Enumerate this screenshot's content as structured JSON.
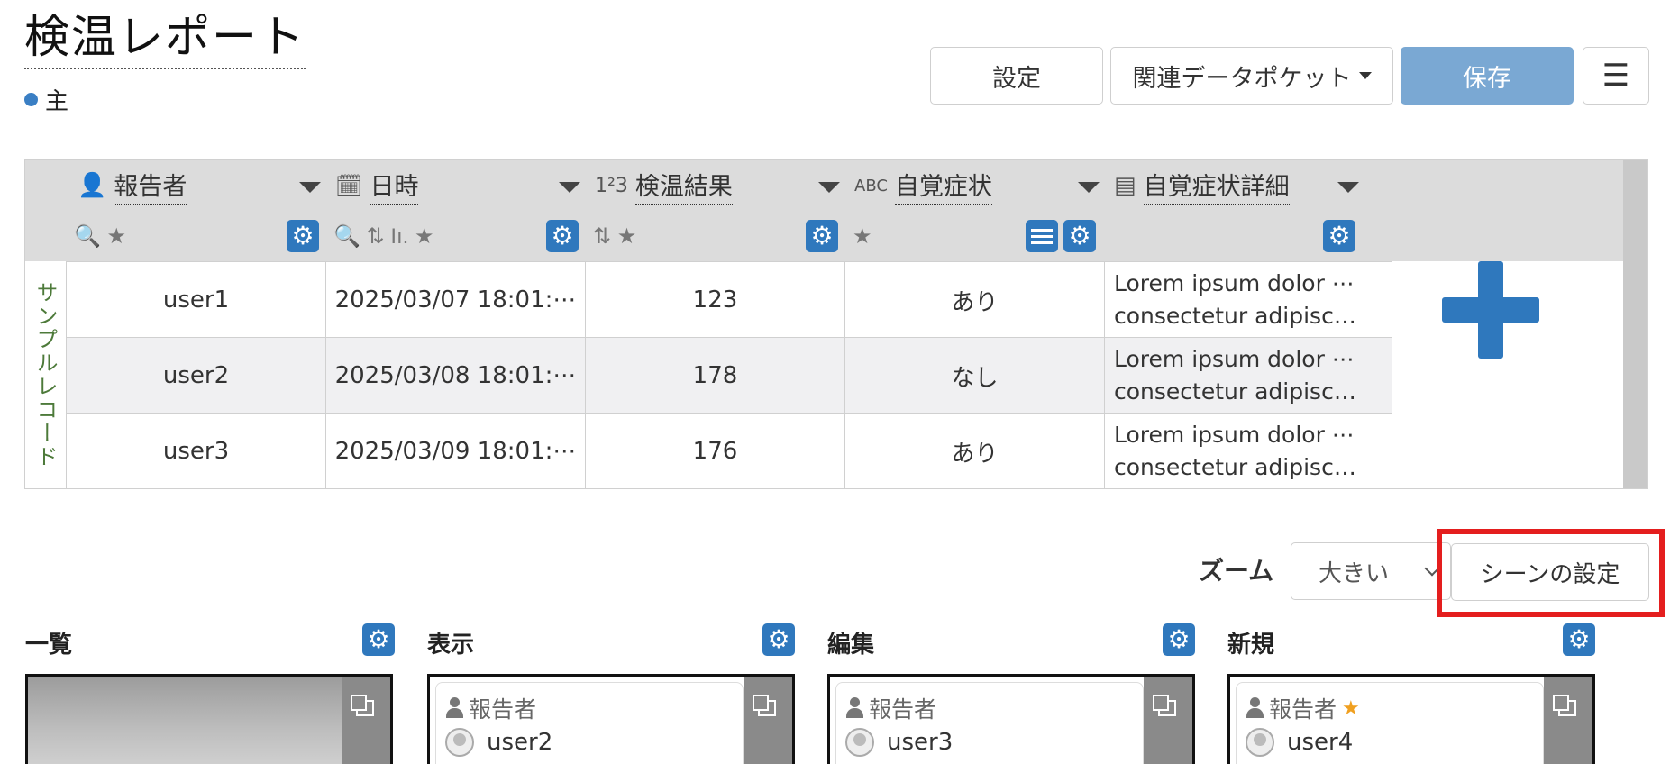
{
  "header": {
    "title": "検温レポート",
    "subtitle": "主"
  },
  "toolbar": {
    "settings_label": "設定",
    "pocket_label": "関連データポケット",
    "save_label": "保存"
  },
  "grid": {
    "side_label": "サンプルレコード",
    "columns": [
      {
        "label": "報告者",
        "tools": "🔍 ★"
      },
      {
        "label": "日時",
        "tools": "🔍 ⇅ Iı. ★"
      },
      {
        "label": "検温結果",
        "tools": "⇅ ★"
      },
      {
        "label": "自覚症状",
        "tools": "★"
      },
      {
        "label": "自覚症状詳細",
        "tools": ""
      }
    ],
    "rows": [
      {
        "reporter": "user1",
        "datetime": "2025/03/07 18:01:⋯",
        "temp": "123",
        "symptom": "あり",
        "detail1": "Lorem ipsum dolor ⋯",
        "detail2": "consectetur adipisci⋯"
      },
      {
        "reporter": "user2",
        "datetime": "2025/03/08 18:01:⋯",
        "temp": "178",
        "symptom": "なし",
        "detail1": "Lorem ipsum dolor ⋯",
        "detail2": "consectetur adipisci⋯"
      },
      {
        "reporter": "user3",
        "datetime": "2025/03/09 18:01:⋯",
        "temp": "176",
        "symptom": "あり",
        "detail1": "Lorem ipsum dolor ⋯",
        "detail2": "consectetur adipisci⋯"
      }
    ]
  },
  "zoom": {
    "label": "ズーム",
    "value": "大きい"
  },
  "scene_settings_label": "シーンの設定",
  "scenes": [
    {
      "title": "一覧"
    },
    {
      "title": "表示",
      "field_label": "報告者",
      "field_value": "user2"
    },
    {
      "title": "編集",
      "field_label": "報告者",
      "field_value": "user3"
    },
    {
      "title": "新規",
      "field_label": "報告者",
      "field_value": "user4"
    }
  ],
  "colors": {
    "accent": "#2f78bd",
    "save_button": "#7aa8d3",
    "highlight": "#e41e1e"
  }
}
